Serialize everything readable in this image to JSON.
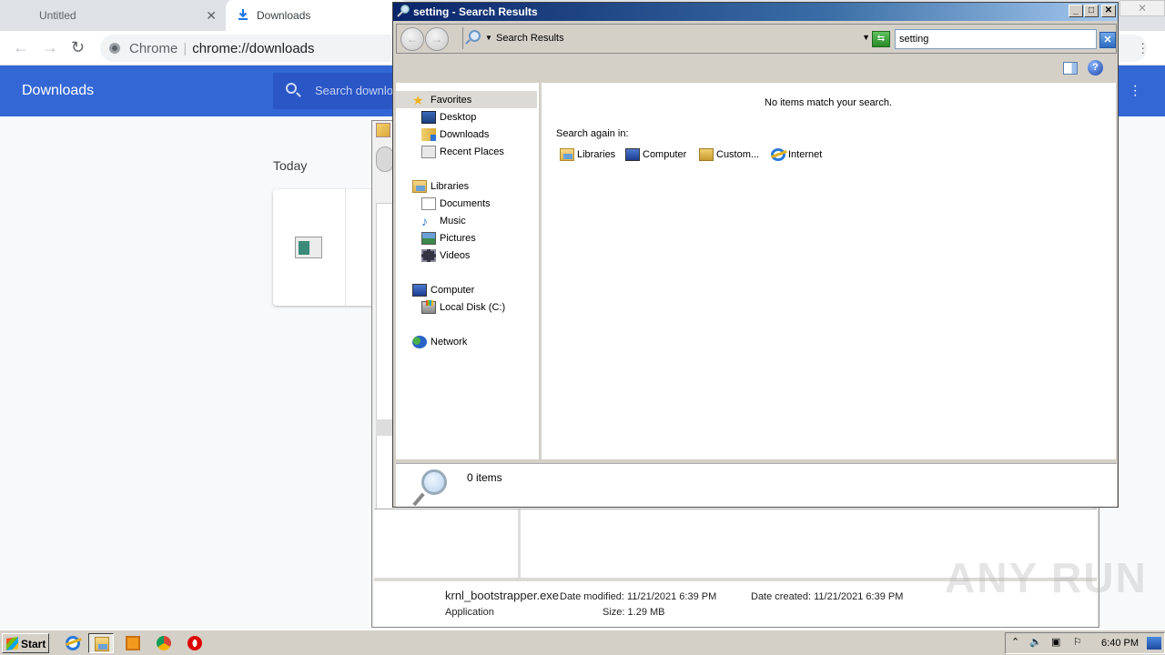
{
  "chrome": {
    "tabs": [
      {
        "label": "Untitled",
        "active": false
      },
      {
        "label": "Downloads",
        "active": true
      }
    ],
    "omnibox": {
      "origin_label": "Chrome",
      "url": "chrome://downloads"
    },
    "downloads_page": {
      "title": "Downloads",
      "search_placeholder": "Search downloads",
      "section_label": "Today"
    }
  },
  "back_explorer": {
    "details": {
      "file_name": "krnl_bootstrapper.exe",
      "file_type": "Application",
      "date_modified_label": "Date modified:",
      "date_modified": "11/21/2021 6:39 PM",
      "size_label": "Size:",
      "size": "1.29 MB",
      "date_created_label": "Date created:",
      "date_created": "11/21/2021 6:39 PM"
    }
  },
  "search_window": {
    "title": "setting - Search Results",
    "address": "Search Results",
    "search_query": "setting",
    "nav_pane": [
      {
        "label": "Favorites",
        "icon": "star-icon",
        "level": 0,
        "selected": true
      },
      {
        "label": "Desktop",
        "icon": "desktop-icon",
        "level": 1
      },
      {
        "label": "Downloads",
        "icon": "downloads-folder-icon",
        "level": 1
      },
      {
        "label": "Recent Places",
        "icon": "recent-places-icon",
        "level": 1
      },
      {
        "label": "Libraries",
        "icon": "libraries-icon",
        "level": 0
      },
      {
        "label": "Documents",
        "icon": "documents-icon",
        "level": 1
      },
      {
        "label": "Music",
        "icon": "music-icon",
        "level": 1
      },
      {
        "label": "Pictures",
        "icon": "pictures-icon",
        "level": 1
      },
      {
        "label": "Videos",
        "icon": "videos-icon",
        "level": 1
      },
      {
        "label": "Computer",
        "icon": "computer-icon",
        "level": 0
      },
      {
        "label": "Local Disk (C:)",
        "icon": "local-disk-icon",
        "level": 1
      },
      {
        "label": "Network",
        "icon": "network-icon",
        "level": 0
      }
    ],
    "no_results_message": "No items match your search.",
    "search_again_label": "Search again in:",
    "search_again_locations": [
      {
        "label": "Libraries",
        "icon": "libraries-icon"
      },
      {
        "label": "Computer",
        "icon": "computer-icon"
      },
      {
        "label": "Custom...",
        "icon": "custom-folder-icon"
      },
      {
        "label": "Internet",
        "icon": "internet-explorer-icon"
      }
    ],
    "status": "0 items"
  },
  "taskbar": {
    "start_label": "Start",
    "apps": [
      {
        "name": "Internet Explorer",
        "icon": "internet-explorer-icon"
      },
      {
        "name": "Windows Explorer",
        "icon": "explorer-icon",
        "active": true
      },
      {
        "name": "Windows Media Player",
        "icon": "media-player-icon"
      },
      {
        "name": "Google Chrome",
        "icon": "chrome-icon"
      },
      {
        "name": "Opera",
        "icon": "opera-icon"
      }
    ],
    "clock": "6:40 PM"
  },
  "watermark": "ANY RUN"
}
